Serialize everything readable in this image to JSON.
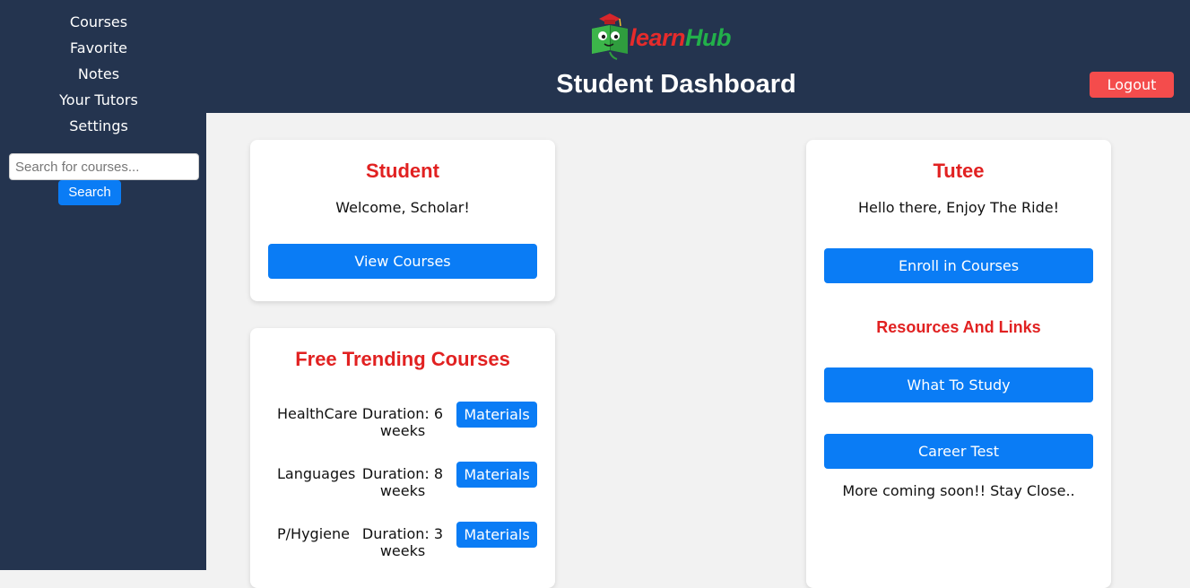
{
  "sidebar": {
    "nav": [
      {
        "label": "Courses"
      },
      {
        "label": "Favorite"
      },
      {
        "label": "Notes"
      },
      {
        "label": "Your Tutors"
      },
      {
        "label": "Settings"
      }
    ],
    "search": {
      "placeholder": "Search for courses...",
      "value": "",
      "button_label": "Search"
    }
  },
  "header": {
    "logo": {
      "part1": "learn",
      "part2": "Hub",
      "icon": "book-mascot-icon"
    },
    "title": "Student Dashboard",
    "logout_label": "Logout"
  },
  "student_card": {
    "title": "Student",
    "welcome": "Welcome, Scholar!",
    "button_label": "View Courses"
  },
  "trending_card": {
    "title": "Free Trending Courses",
    "courses": [
      {
        "name": "HealthCare",
        "duration": "Duration: 6 weeks",
        "button_label": "Materials"
      },
      {
        "name": "Languages",
        "duration": "Duration: 8 weeks",
        "button_label": "Materials"
      },
      {
        "name": "P/Hygiene",
        "duration": "Duration: 3 weeks",
        "button_label": "Materials"
      }
    ]
  },
  "tutee_card": {
    "title": "Tutee",
    "greeting": "Hello there, Enjoy The Ride!",
    "enroll_label": "Enroll in Courses",
    "resources_heading": "Resources And Links",
    "what_to_study_label": "What To Study",
    "career_test_label": "Career Test",
    "footer_note": "More coming soon!! Stay Close.."
  },
  "colors": {
    "navy": "#24344f",
    "primary_blue": "#0a7cf5",
    "accent_red": "#e12121",
    "logout_red": "#f44c4c",
    "logo_green": "#22b04a"
  }
}
